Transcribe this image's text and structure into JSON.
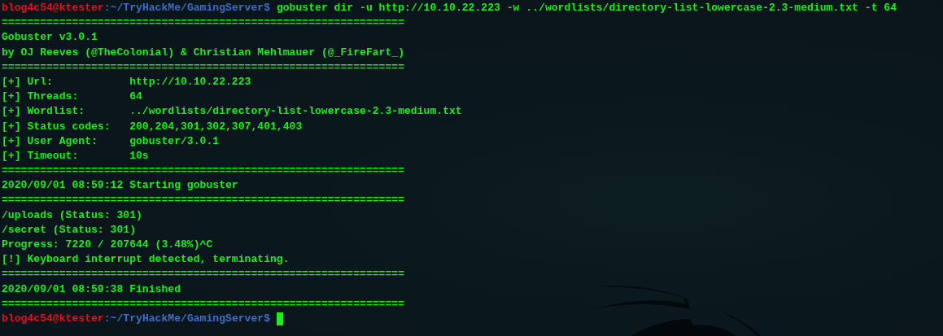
{
  "terminal": {
    "lines": [
      {
        "kind": "prompt",
        "user": "blog4c54@ktester",
        "path": ":~/TryHackMe/GamingServer$",
        "command": "gobuster dir -u http://10.10.22.223 -w ../wordlists/directory-list-lowercase-2.3-medium.txt -t 64",
        "cursor": false
      },
      {
        "kind": "separator",
        "text": "==============================================================="
      },
      {
        "kind": "text",
        "text": "Gobuster v3.0.1"
      },
      {
        "kind": "text",
        "text": "by OJ Reeves (@TheColonial) & Christian Mehlmauer (@_FireFart_)"
      },
      {
        "kind": "separator",
        "text": "==============================================================="
      },
      {
        "kind": "field",
        "label": "[+] Url:",
        "value": "http://10.10.22.223"
      },
      {
        "kind": "field",
        "label": "[+] Threads:",
        "value": "64"
      },
      {
        "kind": "field",
        "label": "[+] Wordlist:",
        "value": "../wordlists/directory-list-lowercase-2.3-medium.txt"
      },
      {
        "kind": "field",
        "label": "[+] Status codes:",
        "value": "200,204,301,302,307,401,403"
      },
      {
        "kind": "field",
        "label": "[+] User Agent:",
        "value": "gobuster/3.0.1"
      },
      {
        "kind": "field",
        "label": "[+] Timeout:",
        "value": "10s"
      },
      {
        "kind": "separator",
        "text": "==============================================================="
      },
      {
        "kind": "text",
        "text": "2020/09/01 08:59:12 Starting gobuster"
      },
      {
        "kind": "separator",
        "text": "==============================================================="
      },
      {
        "kind": "text",
        "text": "/uploads (Status: 301)"
      },
      {
        "kind": "text",
        "text": "/secret (Status: 301)"
      },
      {
        "kind": "text",
        "text": "Progress: 7220 / 207644 (3.48%)^C"
      },
      {
        "kind": "text",
        "text": "[!] Keyboard interrupt detected, terminating."
      },
      {
        "kind": "separator",
        "text": "==============================================================="
      },
      {
        "kind": "text",
        "text": "2020/09/01 08:59:38 Finished"
      },
      {
        "kind": "separator",
        "text": "==============================================================="
      },
      {
        "kind": "prompt",
        "user": "blog4c54@ktester",
        "path": ":~/TryHackMe/GamingServer$",
        "cursor": true
      }
    ]
  }
}
